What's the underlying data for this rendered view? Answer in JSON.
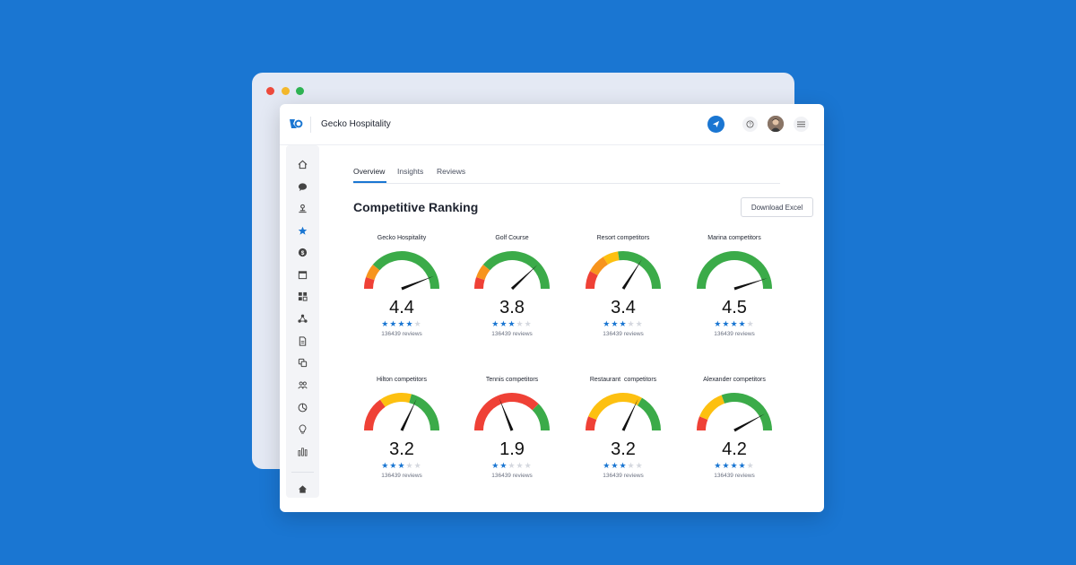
{
  "app": {
    "title": "Gecko Hospitality"
  },
  "tabs": [
    {
      "label": "Overview",
      "active": true
    },
    {
      "label": "Insights",
      "active": false
    },
    {
      "label": "Reviews",
      "active": false
    }
  ],
  "section_title": "Competitive Ranking",
  "download_label": "Download Excel",
  "sidebar_icons": [
    "home-icon",
    "chat-icon",
    "location-pin-icon",
    "star-icon",
    "dollar-icon",
    "calendar-icon",
    "grid-icon",
    "nodes-icon",
    "document-icon",
    "copy-icon",
    "people-icon",
    "pie-chart-icon",
    "lightbulb-icon",
    "bar-chart-icon",
    "home-icon"
  ],
  "colors": {
    "brand": "#1a76d2",
    "red": "#ef4136",
    "orange": "#f7941d",
    "yellow": "#fdc010",
    "green": "#3bab49"
  },
  "gauges": [
    {
      "title": "Gecko Hospitality",
      "value": "4.4",
      "stars": 4,
      "reviews": "136439 reviews",
      "zones": [
        "red",
        "orange",
        "green"
      ],
      "needle": 4.4
    },
    {
      "title": "Golf Course",
      "value": "3.8",
      "stars": 3,
      "reviews": "136439 reviews",
      "zones": [
        "red",
        "orange",
        "green"
      ],
      "needle": 3.8
    },
    {
      "title": "Resort competitors",
      "value": "3.4",
      "stars": 3,
      "reviews": "136439 reviews",
      "zones": [
        "red",
        "orange",
        "yellow",
        "green"
      ],
      "needle": 3.4
    },
    {
      "title": "Marina competitors",
      "value": "4.5",
      "stars": 4,
      "reviews": "136439 reviews",
      "zones": [
        "green"
      ],
      "needle": 4.5
    },
    {
      "title": "Hilton competitors",
      "value": "3.2",
      "stars": 3,
      "reviews": "136439 reviews",
      "zones": [
        "red",
        "yellow",
        "green"
      ],
      "needle": 3.2
    },
    {
      "title": "Tennis competitors",
      "value": "1.9",
      "stars": 2,
      "reviews": "136439 reviews",
      "zones": [
        "red",
        "green"
      ],
      "needle": 1.9
    },
    {
      "title": "Restaurant  competitors",
      "value": "3.2",
      "stars": 3,
      "reviews": "136439 reviews",
      "zones": [
        "red",
        "yellow",
        "green"
      ],
      "needle": 3.2
    },
    {
      "title": "Alexander competitors",
      "value": "4.2",
      "stars": 4,
      "reviews": "136439 reviews",
      "zones": [
        "red",
        "yellow",
        "green"
      ],
      "needle": 4.2
    }
  ]
}
